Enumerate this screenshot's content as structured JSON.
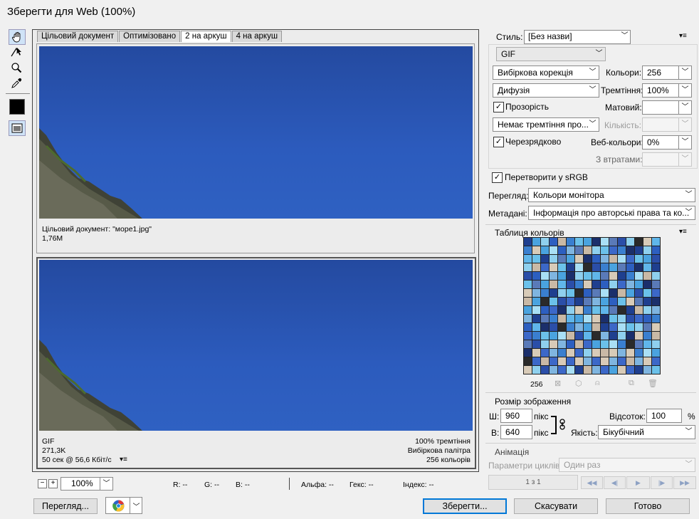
{
  "window": {
    "title": "Зберегти для Web (100%)"
  },
  "tools": [
    {
      "name": "hand-tool-icon",
      "glyph": "✋"
    },
    {
      "name": "slice-select-tool-icon",
      "glyph": "➶"
    },
    {
      "name": "zoom-tool-icon",
      "glyph": "🔍"
    },
    {
      "name": "eyedropper-tool-icon",
      "glyph": "✎"
    }
  ],
  "tabs": [
    "Цільовий документ",
    "Оптимізовано",
    "2 на аркуш",
    "4 на аркуш"
  ],
  "active_tab": "2 на аркуш",
  "pane_top": {
    "line1": "Цільовий документ: \"море1.jpg\"",
    "line2": "1,76M"
  },
  "pane_bottom": {
    "left1": "GIF",
    "left2": "271,3K",
    "left3": "50 сек @ 56,6 Кбіт/с",
    "right1": "100% тремтіння",
    "right2": "Вибіркова палітра",
    "right3": "256 кольорів"
  },
  "statusbar": {
    "zoom": "100%",
    "r": "R: --",
    "g": "G: --",
    "b": "B: --",
    "alpha": "Альфа: --",
    "hex": "Гекс: --",
    "index": "Індекс: --"
  },
  "buttons": {
    "preview": "Перегляд...",
    "save": "Зберегти...",
    "cancel": "Скасувати",
    "done": "Готово"
  },
  "settings": {
    "style_label": "Стиль:",
    "style_value": "[Без назви]",
    "format": "GIF",
    "reduction": "Вибіркова корекція",
    "colors_label": "Кольори:",
    "colors_value": "256",
    "dither_algo": "Дифузія",
    "dither_label": "Тремтіння:",
    "dither_value": "100%",
    "transparency_label": "Прозорість",
    "matte_label": "Матовий:",
    "matte_value": "",
    "transp_dither": "Немає тремтіння про...",
    "amount_label": "Кількість:",
    "amount_value": "",
    "interlaced_label": "Черезрядково",
    "websnap_label": "Веб-кольори:",
    "websnap_value": "0%",
    "lossy_label": "З втратами:",
    "lossy_value": "",
    "srgb_label": "Перетворити у sRGB",
    "preview_label": "Перегляд:",
    "preview_value": "Кольори монітора",
    "metadata_label": "Метадані:",
    "metadata_value": "Інформація про авторські права та ко..."
  },
  "color_table": {
    "title": "Таблиця кольорів",
    "count": "256",
    "palette": [
      "#1f3f8f",
      "#4aa3df",
      "#8fd0ee",
      "#2d5fc0",
      "#c9b9a6",
      "#3a7fcf",
      "#6bc1ea",
      "#1b2f6b",
      "#a9dff5",
      "#5a7ab8",
      "#2b4ea8",
      "#d8cbb8",
      "#7fb5e0",
      "#2a2a2a",
      "#60b6ea",
      "#3c68c8"
    ],
    "pattern": [
      [
        0,
        1,
        2,
        3,
        4,
        5,
        6,
        1,
        7,
        8,
        9,
        10,
        2,
        13,
        11,
        14
      ],
      [
        5,
        11,
        1,
        8,
        3,
        12,
        9,
        4,
        2,
        6,
        15,
        5,
        7,
        0,
        2,
        3
      ],
      [
        14,
        6,
        0,
        2,
        9,
        1,
        11,
        7,
        3,
        12,
        4,
        8,
        15,
        6,
        1,
        10
      ],
      [
        2,
        4,
        15,
        11,
        6,
        0,
        8,
        13,
        10,
        5,
        1,
        9,
        3,
        7,
        14,
        0
      ],
      [
        10,
        3,
        8,
        12,
        1,
        7,
        2,
        6,
        14,
        9,
        11,
        0,
        5,
        8,
        4,
        2
      ],
      [
        6,
        9,
        1,
        4,
        14,
        10,
        5,
        11,
        0,
        3,
        2,
        15,
        12,
        1,
        7,
        9
      ],
      [
        11,
        12,
        5,
        0,
        2,
        6,
        13,
        3,
        9,
        8,
        7,
        4,
        1,
        10,
        6,
        15
      ],
      [
        4,
        1,
        13,
        6,
        10,
        15,
        0,
        9,
        12,
        1,
        3,
        6,
        11,
        9,
        0,
        7
      ],
      [
        1,
        8,
        3,
        15,
        7,
        2,
        11,
        5,
        6,
        14,
        9,
        13,
        0,
        4,
        2,
        12
      ],
      [
        12,
        0,
        9,
        5,
        4,
        14,
        1,
        8,
        11,
        7,
        6,
        2,
        10,
        15,
        3,
        5
      ],
      [
        3,
        14,
        7,
        10,
        13,
        5,
        12,
        1,
        4,
        0,
        15,
        8,
        6,
        2,
        9,
        11
      ],
      [
        15,
        5,
        6,
        1,
        8,
        4,
        10,
        14,
        13,
        12,
        0,
        2,
        7,
        11,
        5,
        4
      ],
      [
        9,
        10,
        2,
        11,
        12,
        3,
        4,
        15,
        1,
        6,
        8,
        5,
        13,
        9,
        14,
        2
      ],
      [
        7,
        11,
        15,
        12,
        5,
        11,
        15,
        2,
        11,
        4,
        11,
        12,
        11,
        5,
        8,
        1
      ],
      [
        13,
        15,
        4,
        15,
        11,
        15,
        11,
        12,
        15,
        11,
        12,
        15,
        4,
        12,
        11,
        15
      ],
      [
        11,
        2,
        10,
        12,
        15,
        8,
        0,
        4,
        12,
        15,
        1,
        11,
        15,
        0,
        12,
        6
      ]
    ]
  },
  "image_size": {
    "title": "Розмір зображення",
    "w_label": "Ш:",
    "w_value": "960",
    "w_unit": "пікс",
    "h_label": "В:",
    "h_value": "640",
    "h_unit": "пікс",
    "percent_label": "Відсоток:",
    "percent_value": "100",
    "percent_unit": "%",
    "quality_label": "Якість:",
    "quality_value": "Бікубічний"
  },
  "animation": {
    "title": "Анімація",
    "loop_label": "Параметри циклів:",
    "loop_value": "Один раз",
    "frame_counter": "1 з 1"
  }
}
